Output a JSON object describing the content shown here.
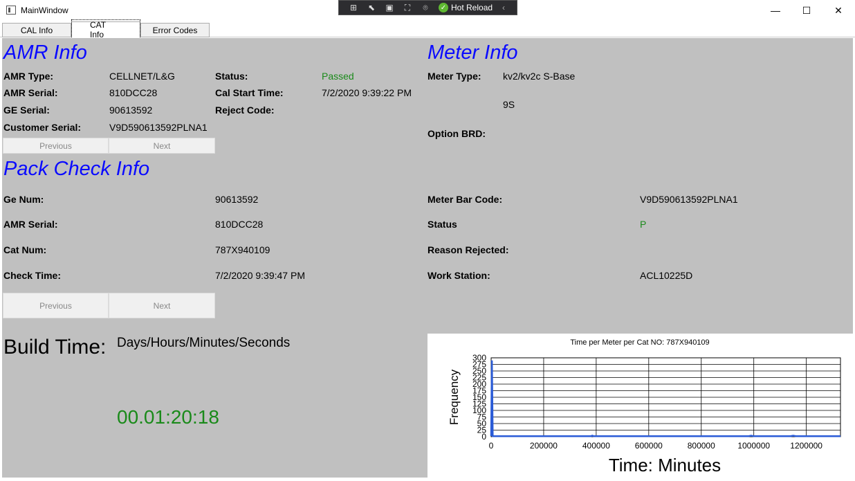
{
  "window": {
    "title": "MainWindow",
    "hot_reload": "Hot Reload",
    "controls": {
      "minimize": "—",
      "maximize": "☐",
      "close": "✕"
    }
  },
  "tabs": [
    {
      "label": "CAL Info",
      "active": false
    },
    {
      "label": "CAT Info",
      "active": true
    },
    {
      "label": "Error Codes",
      "active": false
    }
  ],
  "amr_info": {
    "title": "AMR Info",
    "amr_type_label": "AMR Type:",
    "amr_type": "CELLNET/L&G",
    "amr_serial_label": "AMR Serial:",
    "amr_serial": "810DCC28",
    "ge_serial_label": "GE Serial:",
    "ge_serial": "90613592",
    "customer_serial_label": "Customer Serial:",
    "customer_serial": "V9D590613592PLNA1",
    "status_label": "Status:",
    "status": "Passed",
    "cal_start_label": "Cal  Start Time:",
    "cal_start": "7/2/2020 9:39:22 PM",
    "reject_code_label": "Reject Code:",
    "reject_code": "",
    "previous_label": "Previous",
    "next_label": "Next"
  },
  "meter_info": {
    "title": "Meter Info",
    "meter_type_label": "Meter Type:",
    "meter_type": "kv2/kv2c S-Base",
    "meter_form": "9S",
    "option_brd_label": "Option BRD:",
    "option_brd": ""
  },
  "pack_check": {
    "title": "Pack Check Info",
    "ge_num_label": "Ge Num:",
    "ge_num": "90613592",
    "amr_serial_label": "AMR Serial:",
    "amr_serial": "810DCC28",
    "cat_num_label": "Cat Num:",
    "cat_num": "787X940109",
    "check_time_label": "Check Time:",
    "check_time": "7/2/2020 9:39:47 PM",
    "meter_bar_code_label": "Meter Bar Code:",
    "meter_bar_code": "V9D590613592PLNA1",
    "status_label": "Status",
    "status": "P",
    "reason_rejected_label": "Reason Rejected:",
    "reason_rejected": "",
    "work_station_label": "Work Station:",
    "work_station": "ACL10225D",
    "previous_label": "Previous",
    "next_label": "Next"
  },
  "build_time": {
    "label": "Build Time:",
    "format": "Days/Hours/Minutes/Seconds",
    "value": "00.01:20:18"
  },
  "colors": {
    "accent_blue": "#0a0aff",
    "status_green": "#1a8a1a",
    "panel_gray": "#c0c0c0",
    "series_blue": "#2a5bd7"
  },
  "chart_data": {
    "type": "line",
    "title": "Time per Meter per Cat NO: 787X940109",
    "xlabel": "Time: Minutes",
    "ylabel": "Frequency",
    "xlim": [
      0,
      1330000
    ],
    "ylim": [
      0,
      300
    ],
    "x_ticks": [
      0,
      200000,
      400000,
      600000,
      800000,
      1000000,
      1200000
    ],
    "y_ticks": [
      0,
      25,
      50,
      75,
      100,
      125,
      150,
      175,
      200,
      225,
      250,
      275,
      300
    ],
    "x_tick_labels": [
      "0",
      "200000",
      "400000",
      "600000",
      "800000",
      "1000000",
      "1200000"
    ],
    "y_tick_labels": [
      "0",
      "25",
      "50",
      "75",
      "100",
      "125",
      "150",
      "175",
      "200",
      "225",
      "250",
      "275",
      "300"
    ],
    "grid": true,
    "series": [
      {
        "x": [
          0,
          3000,
          6000,
          12000,
          380000,
          385000,
          390000,
          980000,
          990000,
          1000000,
          1140000,
          1150000,
          1160000,
          1330000
        ],
        "values": [
          2,
          290,
          2,
          2,
          2,
          4,
          2,
          2,
          4,
          2,
          2,
          4,
          2,
          2
        ]
      }
    ]
  }
}
